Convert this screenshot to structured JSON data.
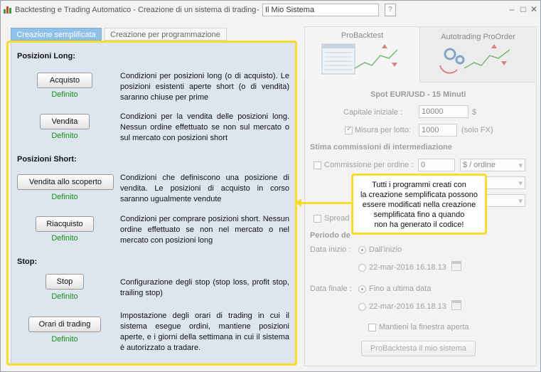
{
  "window": {
    "title": "Backtesting e Trading Automatico - Creazione di un sistema di trading",
    "separator": "-",
    "system_name": "Il Mio Sistema",
    "controls": {
      "help": "?",
      "minimize": "–",
      "maximize": "□",
      "close": "✕"
    }
  },
  "tabs": [
    {
      "label": "Creazione semplificata",
      "active": true
    },
    {
      "label": "Creazione per programmazione",
      "active": false
    }
  ],
  "panel": {
    "long_title": "Posizioni Long:",
    "short_title": "Posizioni Short:",
    "stop_title": "Stop:",
    "items": [
      {
        "button": "Acquisto",
        "status": "Definito",
        "desc": "Condizioni per posizioni long (o di acquisto). Le posizioni esistenti aperte short (o di vendita) saranno chiuse per prime"
      },
      {
        "button": "Vendita",
        "status": "Definito",
        "desc": "Condizioni per la vendita delle posizioni long. Nessun ordine effettuato se non sul mercato o sul mercato con posizioni short"
      },
      {
        "button": "Vendita allo scoperto",
        "status": "Definito",
        "desc": "Condizioni che definiscono una posizione di vendita. Le posizioni di acquisto in corso saranno ugualmente vendute"
      },
      {
        "button": "Riacquisto",
        "status": "Definito",
        "desc": "Condizioni per comprare posizioni short. Nessun ordine effettuato se non nel mercato o nel mercato con posizioni long"
      },
      {
        "button": "Stop",
        "status": "Definito",
        "desc": "Configurazione degli stop (stop loss, profit stop, trailing stop)"
      },
      {
        "button": "Orari di trading",
        "status": "Definito",
        "desc": "Impostazione degli orari di trading in cui il sistema esegue ordini, mantiene posizioni aperte, e i giorni della settimana in cui il sistema è autorizzato a tradare."
      }
    ]
  },
  "right": {
    "tab_probacktest": "ProBacktest",
    "tab_autotrading": "Autotrading ProOrder",
    "instrument": "Spot EUR/USD - 15 Minuti",
    "capital_label": "Capitale iniziale :",
    "capital_value": "10000",
    "capital_unit": "$",
    "lot_label": "Misura per lotto:",
    "lot_value": "1000",
    "lot_unit": "(solo FX)",
    "commission_title": "Stima commissioni di intermediazione",
    "commission_label": "Commissione per ordine :",
    "commission_value": "0",
    "commission_unit": "$ / ordine",
    "spread_label": "Spread",
    "period_title": "Periodo de",
    "start_label": "Data inizio :",
    "start_opt1": "Dall'inizio",
    "start_opt2": "22-mar-2016 16.18.13",
    "end_label": "Data finale :",
    "end_opt1": "Fino a ultima data",
    "end_opt2": "22-mar-2016 16.18.13",
    "keep_open": "Mantieni la finestra aperta",
    "run_button": "ProBacktesta il mio sistema"
  },
  "tooltip": {
    "lines": [
      "Tutti i programmi creati con",
      "la creazione semplificata possono",
      "essere modificati nella creazione",
      "semplificata fino a quando",
      "non ha generato il codice!"
    ]
  }
}
